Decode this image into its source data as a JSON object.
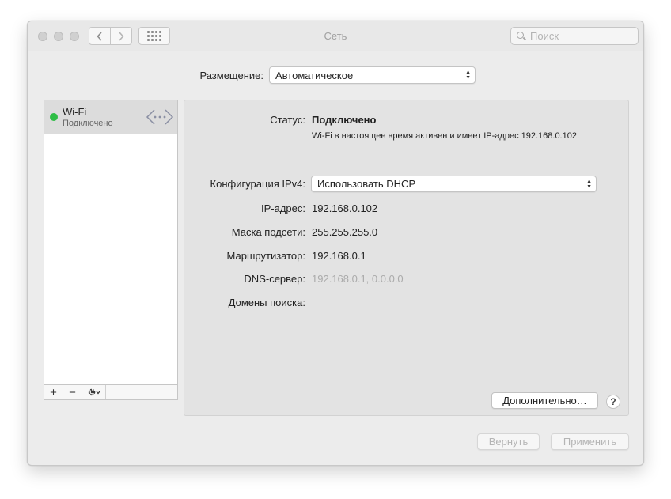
{
  "window": {
    "title": "Сеть"
  },
  "toolbar": {
    "search_placeholder": "Поиск",
    "back_icon": "chevron-left-icon",
    "forward_icon": "chevron-right-icon",
    "grid_icon": "grid-icon"
  },
  "location": {
    "label": "Размещение:",
    "value": "Автоматическое"
  },
  "services": [
    {
      "name": "Wi-Fi",
      "status": "Подключено",
      "status_color": "#2ebd45",
      "icon": "wifi-network-icon"
    }
  ],
  "sidebar_toolbar": {
    "add": "+",
    "remove": "−",
    "gear": "⚙⌄"
  },
  "details": {
    "status_label": "Статус:",
    "status_value": "Подключено",
    "status_description": "Wi-Fi в настоящее время активен и имеет IP-адрес 192.168.0.102.",
    "ipv4_label": "Конфигурация IPv4:",
    "ipv4_value": "Использовать DHCP",
    "ip_label": "IP-адрес:",
    "ip_value": "192.168.0.102",
    "mask_label": "Маска подсети:",
    "mask_value": "255.255.255.0",
    "router_label": "Маршрутизатор:",
    "router_value": "192.168.0.1",
    "dns_label": "DNS-сервер:",
    "dns_value": "192.168.0.1, 0.0.0.0",
    "domains_label": "Домены поиска:",
    "advanced_button": "Дополнительно…",
    "help_button": "?"
  },
  "footer": {
    "revert_button": "Вернуть",
    "apply_button": "Применить"
  }
}
